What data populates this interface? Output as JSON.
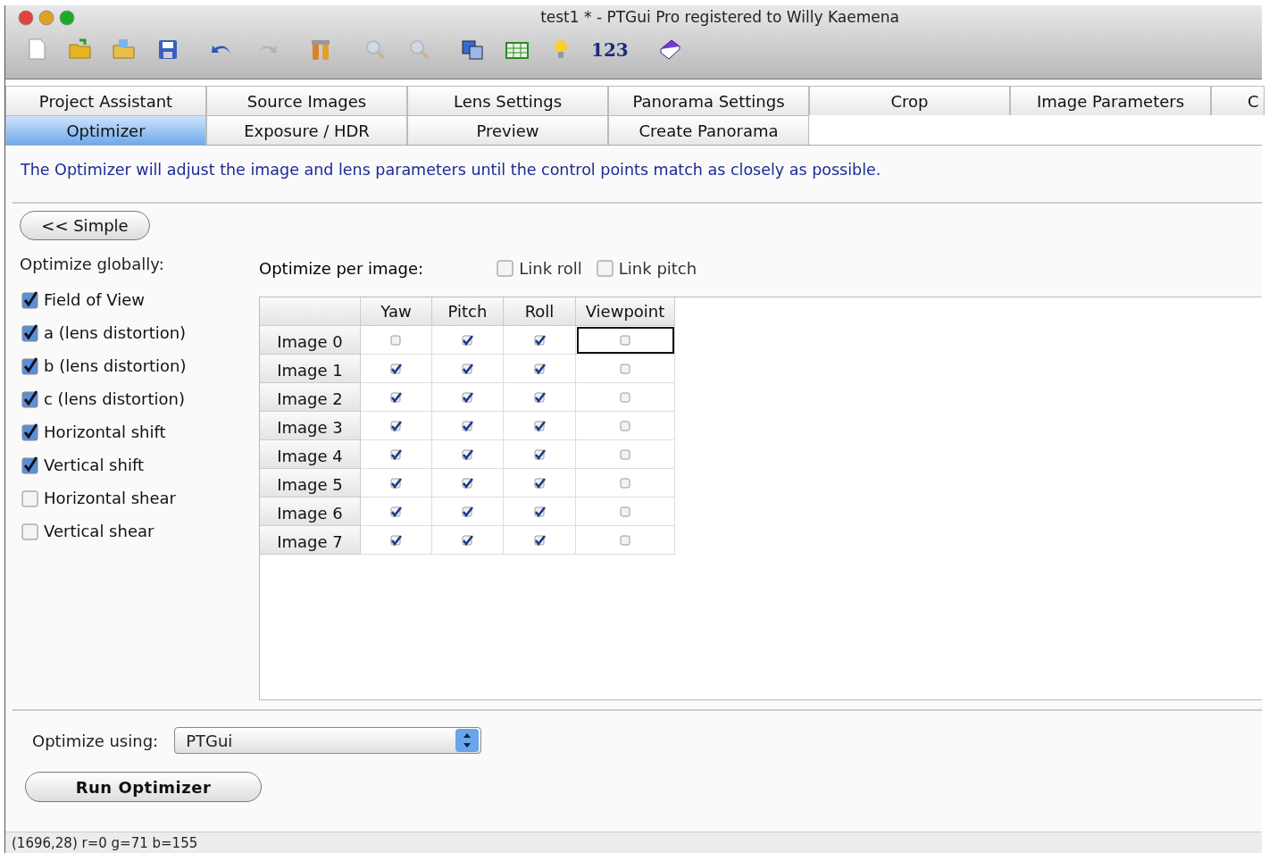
{
  "window": {
    "title": "test1 * - PTGui Pro registered to Willy Kaemena"
  },
  "toolbar": [
    {
      "kind": "new",
      "disabled": false
    },
    {
      "kind": "open",
      "disabled": false
    },
    {
      "kind": "add",
      "disabled": false
    },
    {
      "kind": "save",
      "disabled": false
    },
    {
      "kind": "sep"
    },
    {
      "kind": "undo",
      "disabled": false
    },
    {
      "kind": "redo",
      "disabled": true
    },
    {
      "kind": "sep"
    },
    {
      "kind": "tools",
      "disabled": false
    },
    {
      "kind": "sep"
    },
    {
      "kind": "zoom-in",
      "disabled": true
    },
    {
      "kind": "zoom-out",
      "disabled": true
    },
    {
      "kind": "sep"
    },
    {
      "kind": "windows",
      "disabled": false
    },
    {
      "kind": "table",
      "disabled": false
    },
    {
      "kind": "bulb",
      "disabled": false
    },
    {
      "kind": "text",
      "label": "123"
    },
    {
      "kind": "sep"
    },
    {
      "kind": "book",
      "disabled": false
    }
  ],
  "tabs": [
    [
      {
        "label": "Project Assistant",
        "selected": false
      },
      {
        "label": "Source Images",
        "selected": false
      },
      {
        "label": "Lens Settings",
        "selected": false
      },
      {
        "label": "Panorama Settings",
        "selected": false
      },
      {
        "label": "Crop",
        "selected": false
      },
      {
        "label": "Image Parameters",
        "selected": false
      },
      {
        "label": "C",
        "selected": false
      }
    ],
    [
      {
        "label": "Optimizer",
        "selected": true
      },
      {
        "label": "Exposure / HDR",
        "selected": false
      },
      {
        "label": "Preview",
        "selected": false
      },
      {
        "label": "Create Panorama",
        "selected": false
      }
    ]
  ],
  "description": "The Optimizer will adjust the image and lens parameters until the control points match as closely as possible.",
  "simple_button": "<< Simple",
  "global": {
    "label": "Optimize globally:",
    "items": [
      {
        "label": "Field of View",
        "checked": true
      },
      {
        "label": "a (lens distortion)",
        "checked": true
      },
      {
        "label": "b (lens distortion)",
        "checked": true
      },
      {
        "label": "c (lens distortion)",
        "checked": true
      },
      {
        "label": "Horizontal shift",
        "checked": true
      },
      {
        "label": "Vertical shift",
        "checked": true
      },
      {
        "label": "Horizontal shear",
        "checked": false
      },
      {
        "label": "Vertical shear",
        "checked": false
      }
    ]
  },
  "per_image": {
    "label": "Optimize per image:",
    "links": [
      {
        "label": "Link roll",
        "checked": false
      },
      {
        "label": "Link pitch",
        "checked": false
      }
    ],
    "columns": [
      "Yaw",
      "Pitch",
      "Roll",
      "Viewpoint"
    ],
    "rows": [
      {
        "label": "Image 0",
        "cells": [
          {
            "checked": false,
            "focused": false
          },
          {
            "checked": true,
            "focused": false
          },
          {
            "checked": true,
            "focused": false
          },
          {
            "checked": false,
            "focused": true
          }
        ]
      },
      {
        "label": "Image 1",
        "cells": [
          {
            "checked": true,
            "focused": false
          },
          {
            "checked": true,
            "focused": false
          },
          {
            "checked": true,
            "focused": false
          },
          {
            "checked": false,
            "focused": false
          }
        ]
      },
      {
        "label": "Image 2",
        "cells": [
          {
            "checked": true,
            "focused": false
          },
          {
            "checked": true,
            "focused": false
          },
          {
            "checked": true,
            "focused": false
          },
          {
            "checked": false,
            "focused": false
          }
        ]
      },
      {
        "label": "Image 3",
        "cells": [
          {
            "checked": true,
            "focused": false
          },
          {
            "checked": true,
            "focused": false
          },
          {
            "checked": true,
            "focused": false
          },
          {
            "checked": false,
            "focused": false
          }
        ]
      },
      {
        "label": "Image 4",
        "cells": [
          {
            "checked": true,
            "focused": false
          },
          {
            "checked": true,
            "focused": false
          },
          {
            "checked": true,
            "focused": false
          },
          {
            "checked": false,
            "focused": false
          }
        ]
      },
      {
        "label": "Image 5",
        "cells": [
          {
            "checked": true,
            "focused": false
          },
          {
            "checked": true,
            "focused": false
          },
          {
            "checked": true,
            "focused": false
          },
          {
            "checked": false,
            "focused": false
          }
        ]
      },
      {
        "label": "Image 6",
        "cells": [
          {
            "checked": true,
            "focused": false
          },
          {
            "checked": true,
            "focused": false
          },
          {
            "checked": true,
            "focused": false
          },
          {
            "checked": false,
            "focused": false
          }
        ]
      },
      {
        "label": "Image 7",
        "cells": [
          {
            "checked": true,
            "focused": false
          },
          {
            "checked": true,
            "focused": false
          },
          {
            "checked": true,
            "focused": false
          },
          {
            "checked": false,
            "focused": false
          }
        ]
      }
    ]
  },
  "optimize_using": {
    "label": "Optimize using:",
    "value": "PTGui"
  },
  "run_button": "Run Optimizer",
  "status_bar": "(1696,28) r=0 g=71 b=155"
}
